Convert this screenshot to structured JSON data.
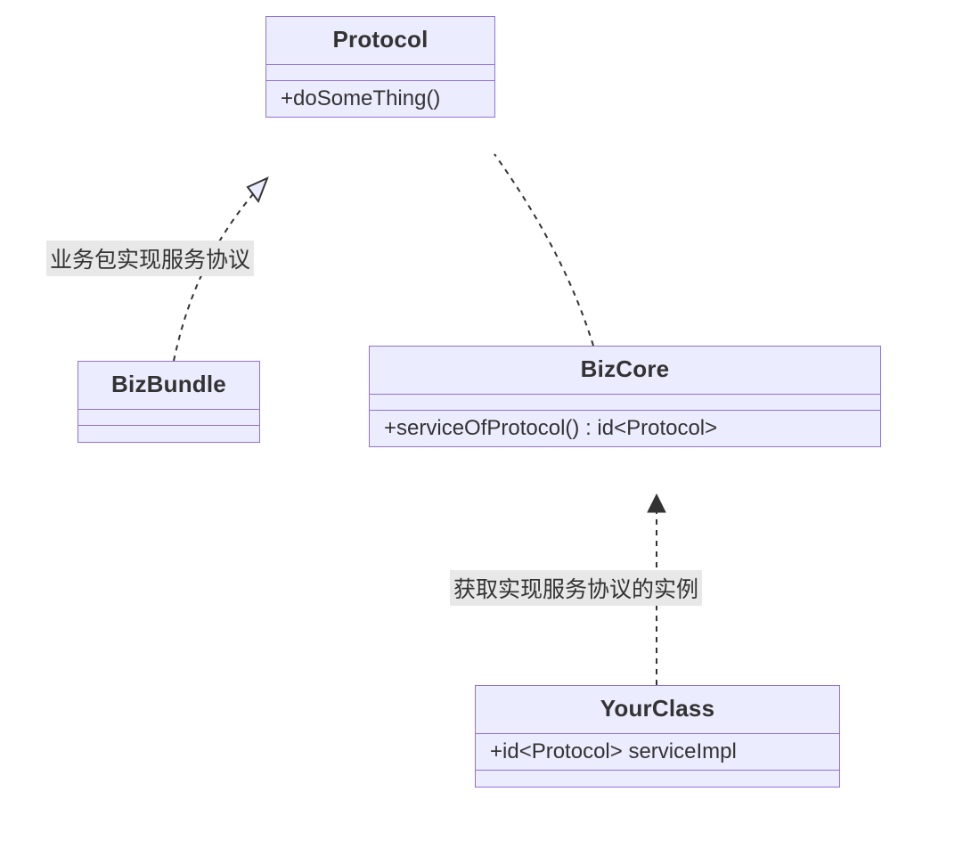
{
  "classes": {
    "protocol": {
      "name": "Protocol",
      "attrs": "",
      "methods": "+doSomeThing()"
    },
    "bizbundle": {
      "name": "BizBundle",
      "attrs": "",
      "methods": ""
    },
    "bizcore": {
      "name": "BizCore",
      "attrs": "",
      "methods": "+serviceOfProtocol() : id<Protocol>"
    },
    "yourclass": {
      "name": "YourClass",
      "attrs": "+id<Protocol> serviceImpl",
      "methods": ""
    }
  },
  "edges": {
    "bizbundle_protocol": {
      "label": "业务包实现服务协议"
    },
    "bizcore_protocol": {
      "label": ""
    },
    "yourclass_bizcore": {
      "label": "获取实现服务协议的实例"
    }
  }
}
